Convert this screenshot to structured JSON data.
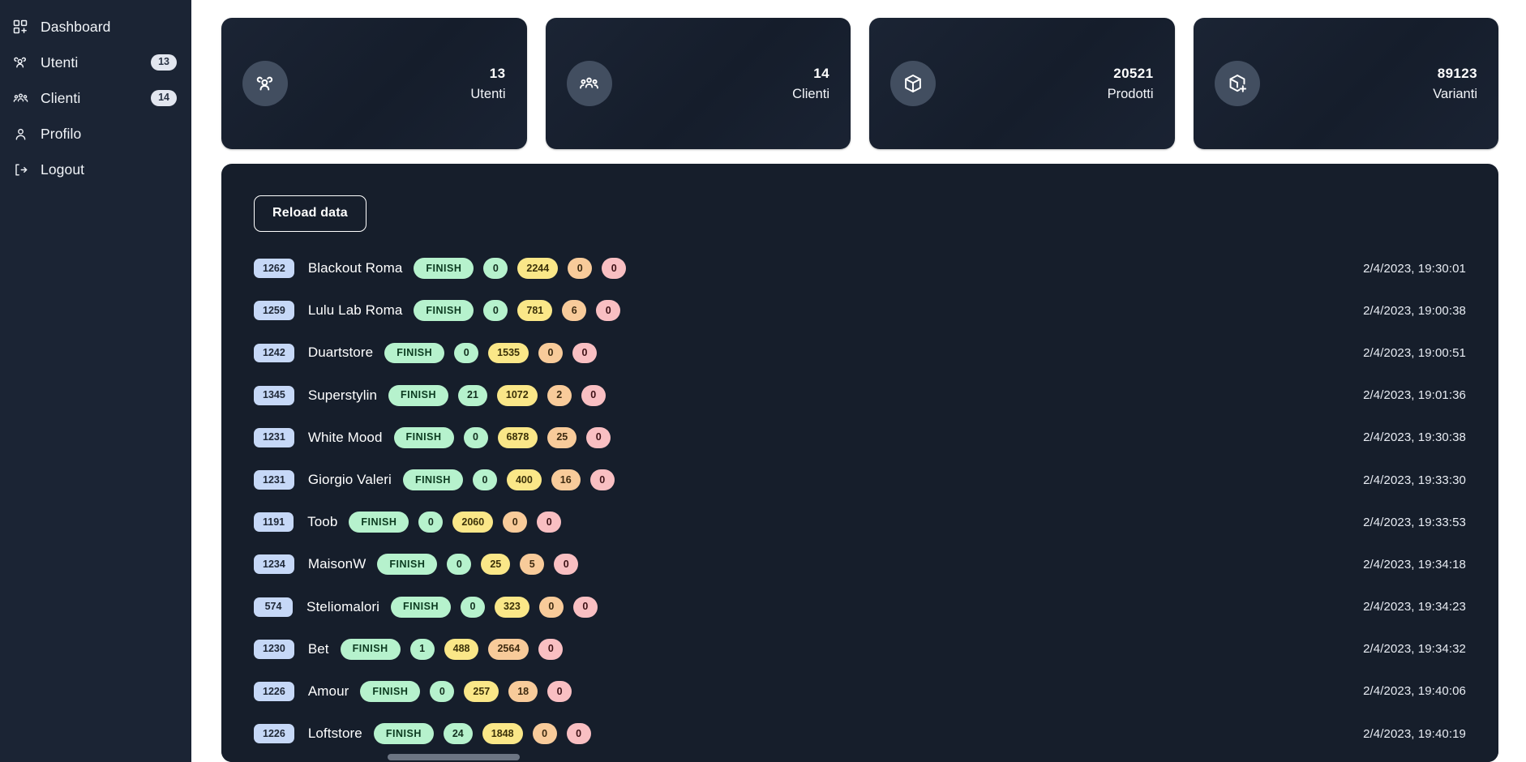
{
  "sidebar": {
    "items": [
      {
        "label": "Dashboard",
        "icon": "dashboard-grid-plus-icon",
        "badge": null
      },
      {
        "label": "Utenti",
        "icon": "users-group-icon",
        "badge": "13"
      },
      {
        "label": "Clienti",
        "icon": "clients-group-icon",
        "badge": "14"
      },
      {
        "label": "Profilo",
        "icon": "user-person-icon",
        "badge": null
      },
      {
        "label": "Logout",
        "icon": "logout-arrow-icon",
        "badge": null
      }
    ]
  },
  "stat_cards": [
    {
      "value": "13",
      "label": "Utenti",
      "icon": "users-group-icon"
    },
    {
      "value": "14",
      "label": "Clienti",
      "icon": "clients-group-icon"
    },
    {
      "value": "20521",
      "label": "Prodotti",
      "icon": "box-icon"
    },
    {
      "value": "89123",
      "label": "Varianti",
      "icon": "box-plus-icon"
    }
  ],
  "panel": {
    "reload_label": "Reload data",
    "rows": [
      {
        "id": "1262",
        "name": "Blackout Roma",
        "status": "FINISH",
        "green": "0",
        "yellow": "2244",
        "orange": "0",
        "pink": "0",
        "time": "2/4/2023, 19:30:01"
      },
      {
        "id": "1259",
        "name": "Lulu Lab Roma",
        "status": "FINISH",
        "green": "0",
        "yellow": "781",
        "orange": "6",
        "pink": "0",
        "time": "2/4/2023, 19:00:38"
      },
      {
        "id": "1242",
        "name": "Duartstore",
        "status": "FINISH",
        "green": "0",
        "yellow": "1535",
        "orange": "0",
        "pink": "0",
        "time": "2/4/2023, 19:00:51"
      },
      {
        "id": "1345",
        "name": "Superstylin",
        "status": "FINISH",
        "green": "21",
        "yellow": "1072",
        "orange": "2",
        "pink": "0",
        "time": "2/4/2023, 19:01:36"
      },
      {
        "id": "1231",
        "name": "White Mood",
        "status": "FINISH",
        "green": "0",
        "yellow": "6878",
        "orange": "25",
        "pink": "0",
        "time": "2/4/2023, 19:30:38"
      },
      {
        "id": "1231",
        "name": "Giorgio Valeri",
        "status": "FINISH",
        "green": "0",
        "yellow": "400",
        "orange": "16",
        "pink": "0",
        "time": "2/4/2023, 19:33:30"
      },
      {
        "id": "1191",
        "name": "Toob",
        "status": "FINISH",
        "green": "0",
        "yellow": "2060",
        "orange": "0",
        "pink": "0",
        "time": "2/4/2023, 19:33:53"
      },
      {
        "id": "1234",
        "name": "MaisonW",
        "status": "FINISH",
        "green": "0",
        "yellow": "25",
        "orange": "5",
        "pink": "0",
        "time": "2/4/2023, 19:34:18"
      },
      {
        "id": "574",
        "name": "Steliomalori",
        "status": "FINISH",
        "green": "0",
        "yellow": "323",
        "orange": "0",
        "pink": "0",
        "time": "2/4/2023, 19:34:23"
      },
      {
        "id": "1230",
        "name": "Bet",
        "status": "FINISH",
        "green": "1",
        "yellow": "488",
        "orange": "2564",
        "pink": "0",
        "time": "2/4/2023, 19:34:32"
      },
      {
        "id": "1226",
        "name": "Amour",
        "status": "FINISH",
        "green": "0",
        "yellow": "257",
        "orange": "18",
        "pink": "0",
        "time": "2/4/2023, 19:40:06"
      },
      {
        "id": "1226",
        "name": "Loftstore",
        "status": "FINISH",
        "green": "24",
        "yellow": "1848",
        "orange": "0",
        "pink": "0",
        "time": "2/4/2023, 19:40:19"
      }
    ]
  },
  "colors": {
    "sidebar_bg": "#1b2434",
    "panel_bg": "#161e2b",
    "card_bg": "#19212f",
    "id_pill": "#c6d8f7",
    "status_green": "#b6f2cd",
    "badge_yellow": "#fae788",
    "badge_orange": "#f8cb9a",
    "badge_pink": "#f9bfc2",
    "text_primary": "#ffffff"
  }
}
